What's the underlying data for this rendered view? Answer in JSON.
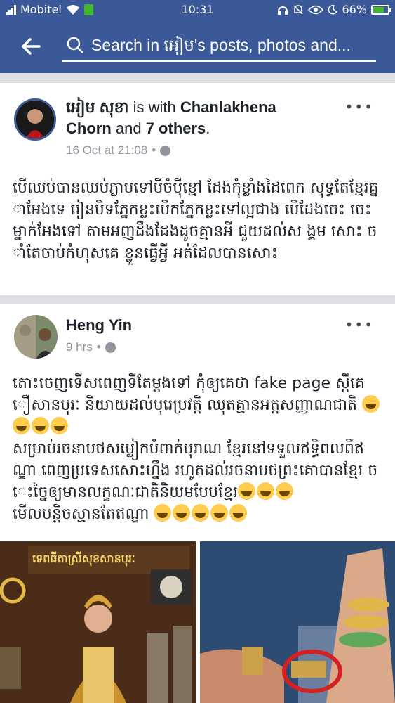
{
  "status_bar": {
    "carrier": "Mobitel",
    "time": "10:31",
    "battery_percent": "66%",
    "battery_level": 0.66,
    "icons": [
      "signal-icon",
      "wifi-icon",
      "sim-icon",
      "headset-icon",
      "mute-icon",
      "eye-icon",
      "moon-icon",
      "battery-icon"
    ]
  },
  "header": {
    "back_icon": "back-arrow-icon",
    "search_placeholder": "Search in អៀម's posts, photos and...",
    "search_icon": "search-icon",
    "color": "#3b5998"
  },
  "posts": [
    {
      "author": "អៀម សុខា",
      "with_prefix": " is with ",
      "tagged": "Chanlakhena",
      "tagged_rest": "Chorn",
      "others_prefix": " and ",
      "others": "7 others",
      "others_suffix": ".",
      "timestamp": "16 Oct at 21:08",
      "separator": "•",
      "privacy_icon": "globe-icon",
      "more": "•••",
      "text": "បើឈប់បានឈប់ភ្លាមទៅមីចំប៉ីខ្មៅ ដែងកុំខ្លាំងដៃពេក សុទ្ធតែខ្មែរគ្នាអែងទេ រៀនបិទភ្នែកខ្លះបើកភ្នែកខ្លះទៅល្អជាង បើដែងចេះ ចេះម្នាក់អែងទៅ តាមអញដឹងដែងដូចគ្មានអី ជួយដល់ស ង្គម សោះ ចាំតែចាប់កំហុសគេ ខ្លួនធ្វើអ្វី អត់ដែលបានសោះ"
    },
    {
      "author": "Heng Yin",
      "timestamp": "9 hrs",
      "separator": "•",
      "privacy_icon": "globe-icon",
      "more": "•••",
      "text_1": "តោះចេញទើសពេញទីតែម្តងទៅ កុំឲ្យគេថា fake page ស្តីគេ ឿសានបុរៈ និយាយដល់បុរេប្រវត្តិ ឈុតគ្មានអត្តសញ្ញាណជាតិ",
      "text_2": "សម្រាប់រចនាបថសម្លៀកបំពាក់បុរាណ ខ្មែរនៅទទួលឥទ្ធិពលពីឥណ្ឌា ពេញប្រទេសសោះហ្នឹង រហូតដល់រចនាបថព្រះគោបានខ្មែរ ចេះច្នៃឲ្យមានលក្ខណៈជាតិនិយមបែបខ្មែរ",
      "text_3": "មើលបន្តិចស្មានតែឥណ្ឌា",
      "emoji_icon": "laughing-tears-emoji-icon",
      "photo_caption": "ទេពធីតាស្រីសុខសានបុរៈ"
    }
  ]
}
